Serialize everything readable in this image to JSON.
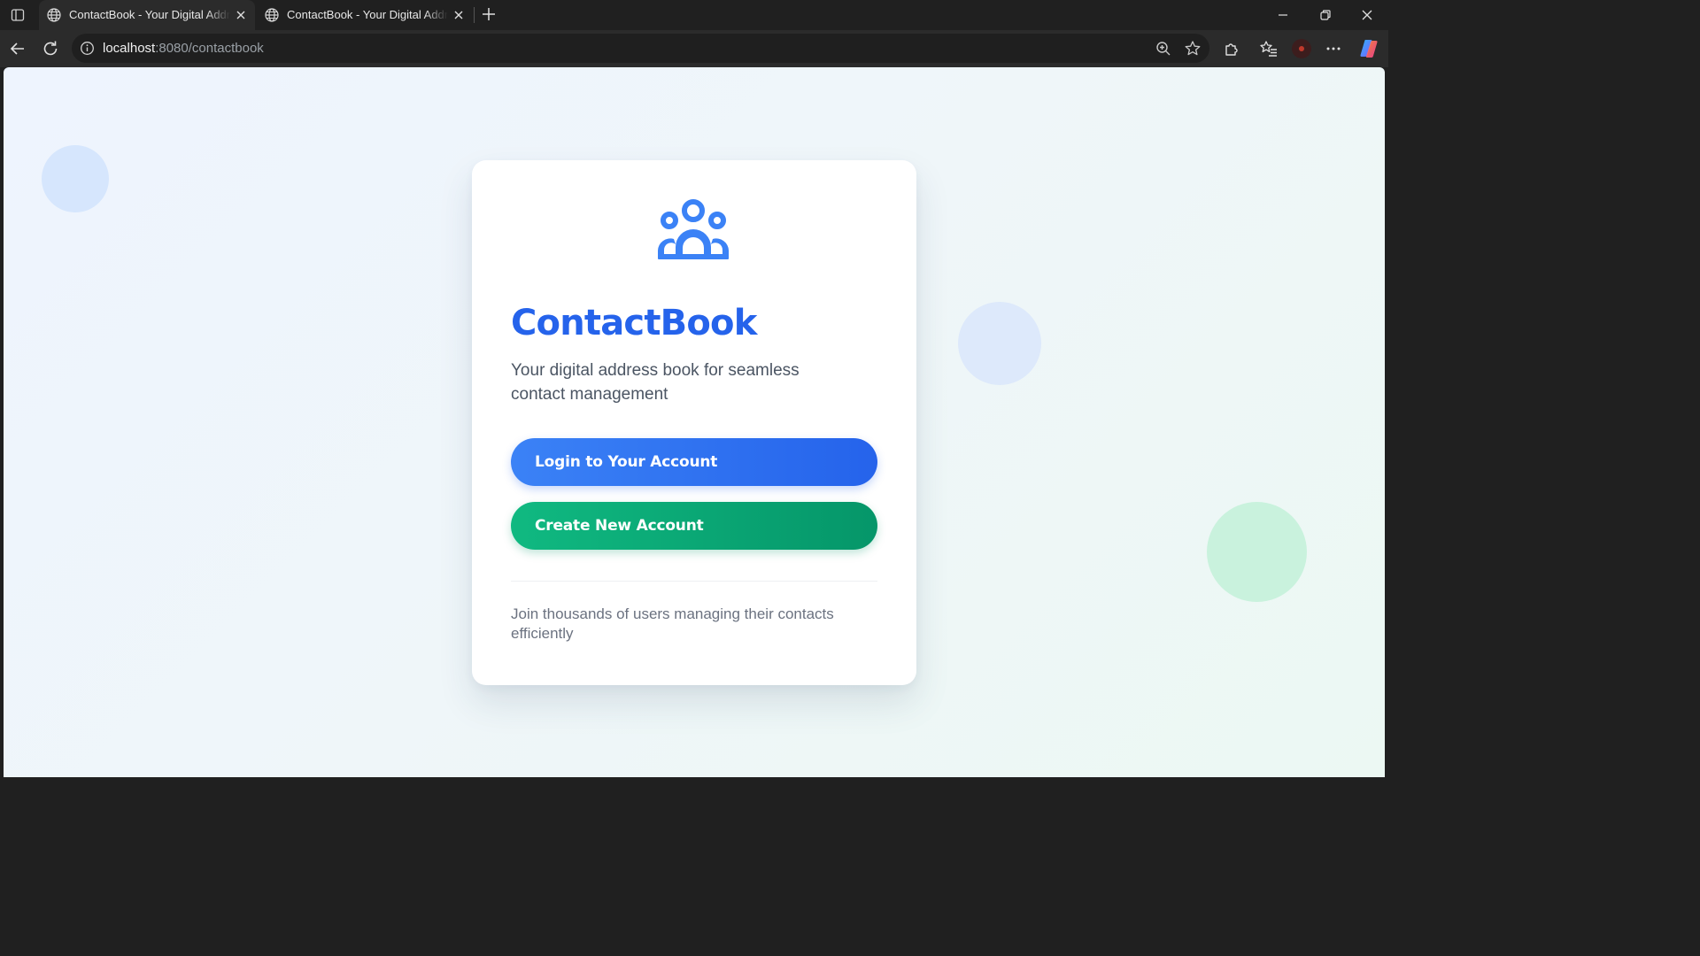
{
  "browser": {
    "tabs": [
      {
        "title": "ContactBook - Your Digital Address Book",
        "active": true
      },
      {
        "title": "ContactBook - Your Digital Address Book",
        "active": false
      }
    ],
    "address": {
      "host": "localhost",
      "rest": ":8080/contactbook"
    },
    "icons": {
      "sidebar": "sidebar-toggle-icon",
      "globe": "globe-icon",
      "close": "close-icon",
      "new_tab": "plus-icon",
      "back": "back-arrow-icon",
      "reload": "reload-icon",
      "info": "info-icon",
      "zoom": "zoom-icon",
      "favorite": "star-icon",
      "extensions": "puzzle-icon",
      "favorites": "favorites-icon",
      "more": "more-icon",
      "copilot": "copilot-icon",
      "minimize": "minimize-icon",
      "restore": "restore-icon"
    }
  },
  "page": {
    "logo_icon": "users-group-icon",
    "brand": "ContactBook",
    "tagline": "Your digital address book for seamless contact management",
    "login_label": "Login to Your Account",
    "create_label": "Create New Account",
    "footer": "Join thousands of users managing their contacts efficiently"
  },
  "colors": {
    "primary": "#2563eb",
    "success": "#059669",
    "text_muted": "#6b7280"
  }
}
